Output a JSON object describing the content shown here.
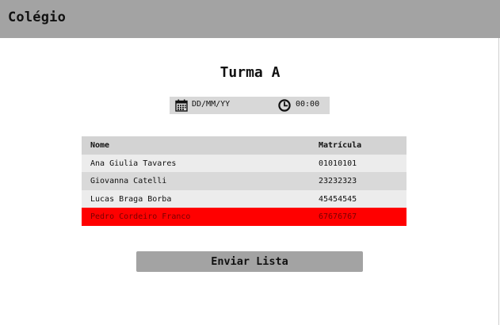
{
  "app": {
    "title": "Colégio"
  },
  "page": {
    "title": "Turma A"
  },
  "datetime": {
    "date_placeholder": "DD/MM/YY",
    "time_placeholder": "00:00",
    "date_icon": "calendar-icon",
    "time_icon": "clock-icon"
  },
  "table": {
    "headers": [
      "Nome",
      "Matrícula"
    ],
    "rows": [
      {
        "nome": "Ana Giulia Tavares",
        "matricula": "01010101"
      },
      {
        "nome": "Giovanna Catelli",
        "matricula": "23232323"
      },
      {
        "nome": "Lucas Braga Borba",
        "matricula": "45454545"
      },
      {
        "nome": "Pedro Cordeiro Franco",
        "matricula": "67676767",
        "highlighted": true
      }
    ]
  },
  "actions": {
    "send_label": "Enviar Lista"
  },
  "colors": {
    "app_bar": "#a3a3a3",
    "highlight_row": "#ff0000",
    "button": "#a3a3a3"
  }
}
